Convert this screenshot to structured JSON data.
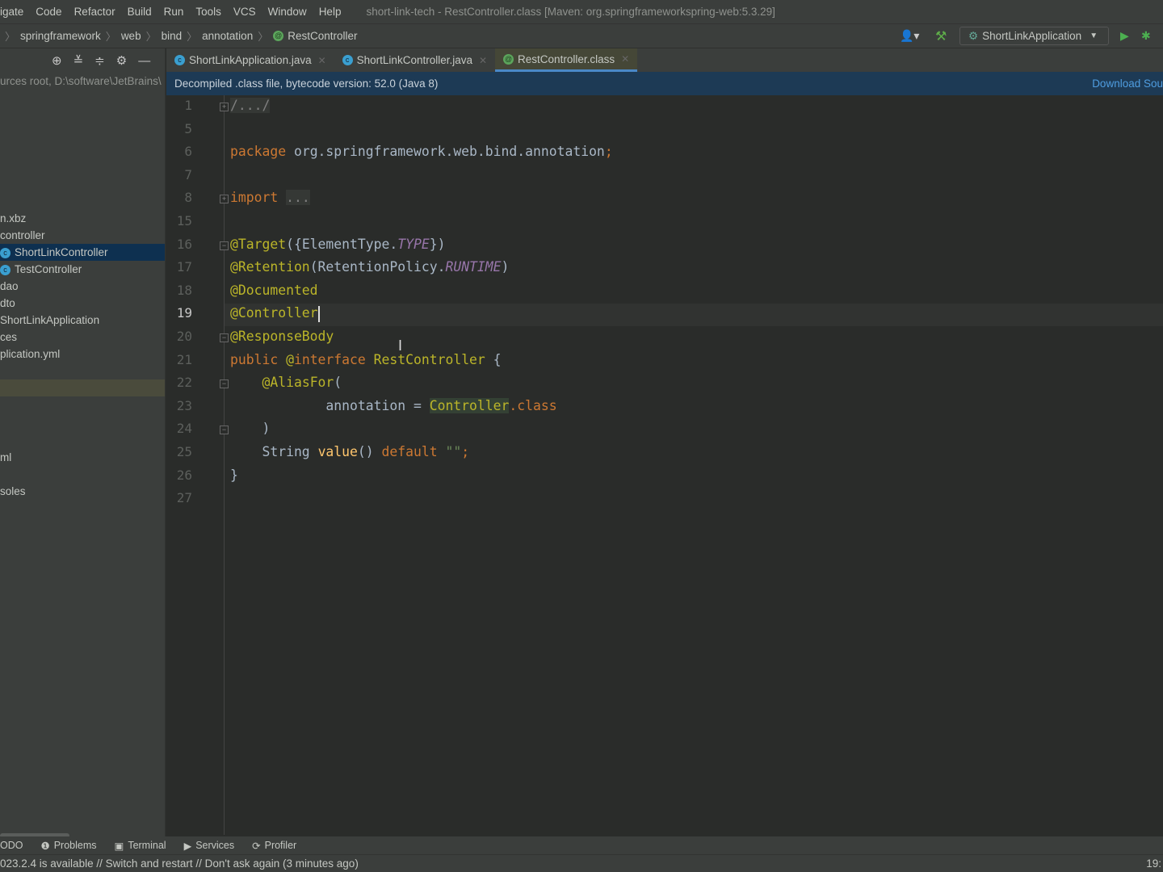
{
  "menu": [
    "igate",
    "Code",
    "Refactor",
    "Build",
    "Run",
    "Tools",
    "VCS",
    "Window",
    "Help"
  ],
  "window_title": "short-link-tech - RestController.class [Maven: org.springframeworkspring-web:5.3.29]",
  "breadcrumb": [
    "springframework",
    "web",
    "bind",
    "annotation",
    "RestController"
  ],
  "run_config": "ShortLinkApplication",
  "tabs": [
    {
      "label": "ShortLinkApplication.java",
      "icon": "spring-boot-class-icon"
    },
    {
      "label": "ShortLinkController.java",
      "icon": "class-icon"
    },
    {
      "label": "RestController.class",
      "icon": "annotation-icon",
      "active": true
    }
  ],
  "banner": {
    "text": "Decompiled .class file, bytecode version: 52.0 (Java 8)",
    "link": "Download Sou"
  },
  "project": {
    "root_hint": "urces root,  D:\\software\\JetBrains\\",
    "items": [
      {
        "label": "n.xbz"
      },
      {
        "label": "controller"
      },
      {
        "label": "ShortLinkController",
        "icon": "class-icon",
        "selected": true
      },
      {
        "label": "TestController",
        "icon": "class-icon"
      },
      {
        "label": "dao"
      },
      {
        "label": "dto"
      },
      {
        "label": "ShortLinkApplication"
      },
      {
        "label": "ces"
      },
      {
        "label": "plication.yml"
      },
      {
        "label": ""
      },
      {
        "label": "ml"
      },
      {
        "label": "soles"
      }
    ]
  },
  "code": {
    "current_line": "19",
    "lines": [
      {
        "n": "1",
        "t": [
          [
            "cm",
            "/.../"
          ]
        ]
      },
      {
        "n": "5",
        "t": []
      },
      {
        "n": "6",
        "t": [
          [
            "kw",
            "package "
          ],
          [
            "ty",
            "org.springframework.web.bind.annotation"
          ],
          [
            "kw",
            ";"
          ]
        ]
      },
      {
        "n": "7",
        "t": []
      },
      {
        "n": "8",
        "t": [
          [
            "kw",
            "import "
          ],
          [
            "cm",
            "..."
          ]
        ]
      },
      {
        "n": "15",
        "t": []
      },
      {
        "n": "16",
        "t": [
          [
            "an",
            "@Target"
          ],
          [
            "ty",
            "({ElementType."
          ],
          [
            "it",
            "TYPE"
          ],
          [
            "ty",
            "})"
          ]
        ]
      },
      {
        "n": "17",
        "t": [
          [
            "an",
            "@Retention"
          ],
          [
            "ty",
            "(RetentionPolicy."
          ],
          [
            "it",
            "RUNTIME"
          ],
          [
            "ty",
            ")"
          ]
        ]
      },
      {
        "n": "18",
        "t": [
          [
            "an",
            "@Documented"
          ]
        ]
      },
      {
        "n": "19",
        "t": [
          [
            "an",
            "@Controller"
          ]
        ]
      },
      {
        "n": "20",
        "t": [
          [
            "an",
            "@ResponseBody"
          ]
        ]
      },
      {
        "n": "21",
        "t": [
          [
            "kw",
            "public "
          ],
          [
            "an",
            "@"
          ],
          [
            "kw",
            "interface "
          ],
          [
            "an",
            "RestController"
          ],
          [
            "ty",
            " {"
          ]
        ]
      },
      {
        "n": "22",
        "t": [
          [
            "ty",
            "    "
          ],
          [
            "an",
            "@AliasFor"
          ],
          [
            "ty",
            "("
          ]
        ]
      },
      {
        "n": "23",
        "t": [
          [
            "ty",
            "            annotation = "
          ],
          [
            "an hl",
            "Controller"
          ],
          [
            "kw",
            ".class"
          ]
        ]
      },
      {
        "n": "24",
        "t": [
          [
            "ty",
            "    )"
          ]
        ]
      },
      {
        "n": "25",
        "t": [
          [
            "ty",
            "    String "
          ],
          [
            "me",
            "value"
          ],
          [
            "ty",
            "() "
          ],
          [
            "kw",
            "default "
          ],
          [
            "st",
            "\"\""
          ],
          [
            "kw",
            ";"
          ]
        ]
      },
      {
        "n": "26",
        "t": [
          [
            "ty",
            "}"
          ]
        ]
      },
      {
        "n": "27",
        "t": []
      }
    ]
  },
  "tool_windows": [
    "ODO",
    "Problems",
    "Terminal",
    "Services",
    "Profiler"
  ],
  "status": {
    "message": "023.2.4 is available // Switch and restart // Don't ask again (3 minutes ago)",
    "position": "19:"
  }
}
